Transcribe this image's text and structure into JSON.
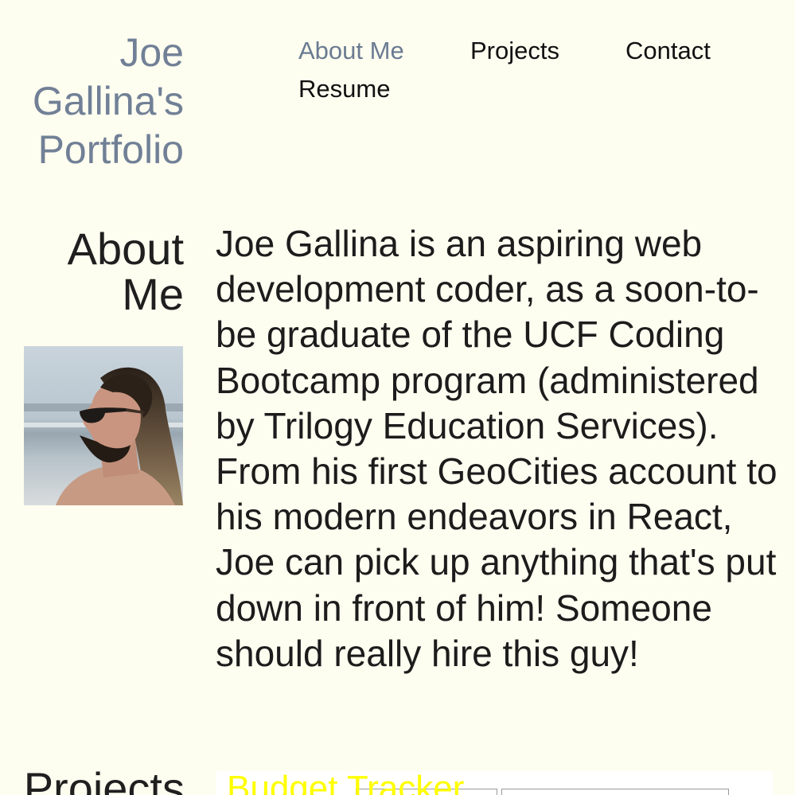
{
  "header": {
    "site_title_lines": [
      "Joe",
      "Gallina's",
      "Portfolio"
    ],
    "nav": [
      {
        "label": "About Me",
        "active": true
      },
      {
        "label": "Projects",
        "active": false
      },
      {
        "label": "Contact",
        "active": false
      },
      {
        "label": "Resume",
        "active": false
      }
    ]
  },
  "about": {
    "heading_lines": [
      "About",
      "Me"
    ],
    "avatar_icon": "profile-photo",
    "bio": "Joe Gallina is an aspiring web development coder, as a soon-to-be graduate of the UCF Coding Bootcamp program (administered by Trilogy Education Services). From his first GeoCities account to his modern endeavors in React, Joe can pick up anything that's put down in front of him! Someone should really hire this guy!"
  },
  "projects": {
    "heading": "Projects",
    "first_project_title": "Budget Tracker"
  },
  "colors": {
    "background": "#fdfdf0",
    "title": "#718096",
    "nav_active": "#6b7b91",
    "project_title": "#ffff00"
  }
}
